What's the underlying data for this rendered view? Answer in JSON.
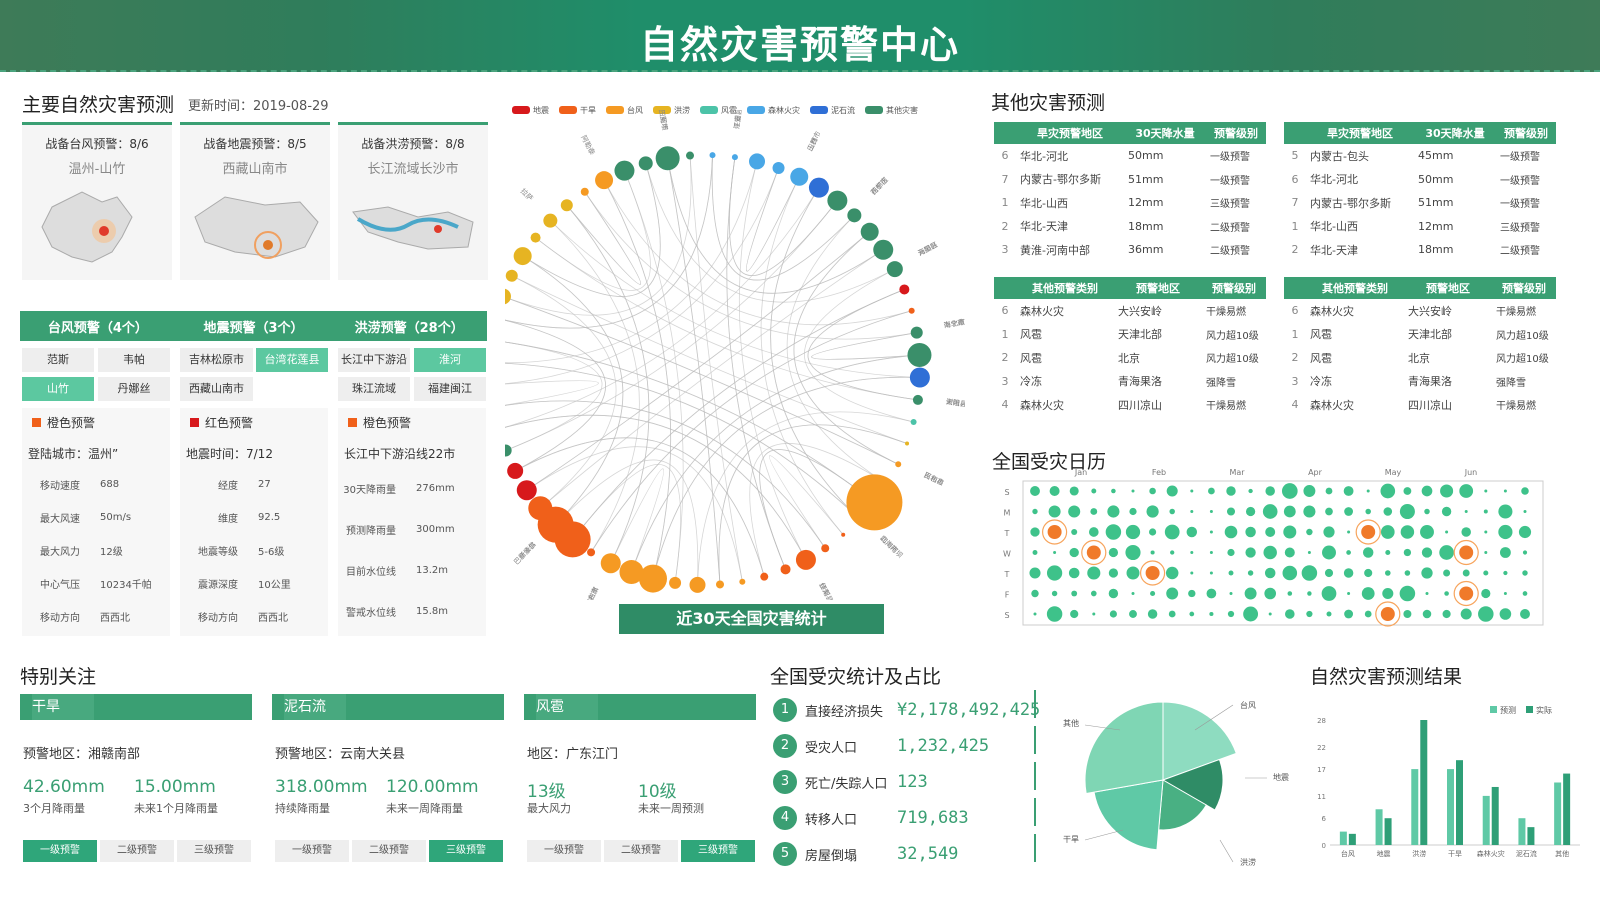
{
  "header": {
    "title": "自然灾害预警中心"
  },
  "left": {
    "title": "主要自然灾害预测",
    "update_label": "更新时间：2019-08-29",
    "cards": [
      {
        "title": "战备台风预警：8/6",
        "place": "温州-山竹"
      },
      {
        "title": "战备地震预警：8/5",
        "place": "西藏山南市"
      },
      {
        "title": "战备洪涝预警：8/8",
        "place": "长江流域长沙市"
      }
    ],
    "tabs": [
      "台风预警（4个）",
      "地震预警（3个）",
      "洪涝预警（28个）"
    ],
    "chips": {
      "typhoon": [
        "范斯",
        "韦帕",
        "山竹",
        "丹娜丝"
      ],
      "quake": [
        "吉林松原市",
        "台湾花莲县",
        "西藏山南市"
      ],
      "flood": [
        "长江中下游沿线",
        "淮河",
        "珠江流域",
        "福建闽江"
      ]
    },
    "details": [
      {
        "level": "橙色预警",
        "line": "登陆城市：温州”",
        "rows": [
          [
            "移动速度",
            "688"
          ],
          [
            "最大风速",
            "50m/s"
          ],
          [
            "最大风力",
            "12级"
          ],
          [
            "中心气压",
            "10234千帕"
          ],
          [
            "移动方向",
            "西西北"
          ]
        ]
      },
      {
        "level": "红色预警",
        "line": "地震时间：7/12",
        "rows": [
          [
            "经度",
            "27"
          ],
          [
            "维度",
            "92.5"
          ],
          [
            "地震等级",
            "5-6级"
          ],
          [
            "震源深度",
            "10公里"
          ],
          [
            "移动方向",
            "西西北"
          ]
        ]
      },
      {
        "level": "橙色预警",
        "line": "长江中下游沿线22市",
        "rows": [
          [
            "30天降雨量",
            "276mm"
          ],
          [
            "预测降雨量",
            "300mm"
          ],
          [
            "目前水位线",
            "13.2m"
          ],
          [
            "警戒水位线",
            "15.8m"
          ]
        ]
      }
    ]
  },
  "center": {
    "legend": [
      "地震",
      "干旱",
      "台风",
      "洪涝",
      "风雹",
      "森林火灾",
      "泥石流",
      "其他灾害"
    ],
    "legend_colors": [
      "#d7191c",
      "#f0601a",
      "#f59a23",
      "#e6b422",
      "#4cc3a8",
      "#49a7e6",
      "#2f6fd6",
      "#3a8f6a"
    ],
    "nodes": [
      "三亚市",
      "平遥县",
      "玉林市",
      "花都区",
      "元阳区",
      "南宁市",
      "天峨县",
      "百色市",
      "北海市",
      "红河县",
      "哈尔滨市",
      "荆州",
      "钦州市",
      "新余县",
      "银宁县",
      "哈巴河县",
      "乌尔禾区",
      "平武县",
      "拉萨",
      "阿勒泰",
      "四川阿坝",
      "江安",
      "山西",
      "西宁市",
      "海晏县",
      "海北藏族自治州",
      "谢阳县",
      "民和县",
      "四川阿坝",
      "伊犁",
      "黄南藏族自治州",
      "玉树藏族",
      "土默特右旗",
      "巴彦淖尔",
      "果洛",
      "西和县",
      "化隆县"
    ],
    "caption": "近30天全国灾害统计"
  },
  "right_top": {
    "title": "其他灾害预测",
    "tbl1_head": [
      "旱灾预警地区",
      "30天降水量",
      "预警级别"
    ],
    "tbl1": [
      [
        "6",
        "华北-河北",
        "50mm",
        "一级预警"
      ],
      [
        "7",
        "内蒙古-鄂尔多斯",
        "51mm",
        "一级预警"
      ],
      [
        "1",
        "华北-山西",
        "12mm",
        "三级预警"
      ],
      [
        "2",
        "华北-天津",
        "18mm",
        "二级预警"
      ],
      [
        "3",
        "黄淮-河南中部",
        "36mm",
        "二级预警"
      ]
    ],
    "tbl2": [
      [
        "5",
        "内蒙古-包头",
        "45mm",
        "一级预警"
      ],
      [
        "6",
        "华北-河北",
        "50mm",
        "一级预警"
      ],
      [
        "7",
        "内蒙古-鄂尔多斯",
        "51mm",
        "一级预警"
      ],
      [
        "1",
        "华北-山西",
        "12mm",
        "三级预警"
      ],
      [
        "2",
        "华北-天津",
        "18mm",
        "二级预警"
      ]
    ],
    "tbl3_head": [
      "其他预警类别",
      "预警地区",
      "预警级别"
    ],
    "tbl3": [
      [
        "6",
        "森林火灾",
        "大兴安岭",
        "干燥易燃"
      ],
      [
        "1",
        "风雹",
        "天津北部",
        "风力超10级"
      ],
      [
        "2",
        "风雹",
        "北京",
        "风力超10级"
      ],
      [
        "3",
        "冷冻",
        "青海果洛",
        "强降雪"
      ],
      [
        "4",
        "森林火灾",
        "四川凉山",
        "干燥易燃"
      ]
    ],
    "tbl4": [
      [
        "6",
        "森林火灾",
        "大兴安岭",
        "干燥易燃"
      ],
      [
        "1",
        "风雹",
        "天津北部",
        "风力超10级"
      ],
      [
        "2",
        "风雹",
        "北京",
        "风力超10级"
      ],
      [
        "3",
        "冷冻",
        "青海果洛",
        "强降雪"
      ],
      [
        "4",
        "森林火灾",
        "四川凉山",
        "干燥易燃"
      ]
    ]
  },
  "calendar": {
    "title": "全国受灾日历",
    "months": [
      "Jan",
      "Feb",
      "Mar",
      "Apr",
      "May",
      "Jun"
    ],
    "days": [
      "S",
      "M",
      "T",
      "W",
      "T",
      "F",
      "S"
    ]
  },
  "focus": {
    "title": "特别关注",
    "items": [
      {
        "name": "干旱",
        "area": "预警地区：湘赣南部",
        "v1": "42.60mm",
        "l1": "3个月降雨量",
        "v2": "15.00mm",
        "l2": "未来1个月降雨量",
        "levels": [
          "一级预警",
          "二级预警",
          "三级预警"
        ],
        "active": 0
      },
      {
        "name": "泥石流",
        "area": "预警地区：云南大关县",
        "v1": "318.00mm",
        "l1": "持续降雨量",
        "v2": "120.00mm",
        "l2": "未来一周降雨量",
        "levels": [
          "一级预警",
          "二级预警",
          "三级预警"
        ],
        "active": 2
      },
      {
        "name": "风雹",
        "area": "地区：广东江门",
        "v1": "13级",
        "l1": "最大风力",
        "v2": "10级",
        "l2": "未来一周预测",
        "levels": [
          "一级预警",
          "二级预警",
          "三级预警"
        ],
        "active": 2
      }
    ]
  },
  "stats": {
    "title": "全国受灾统计及占比",
    "rows": [
      {
        "n": "1",
        "label": "直接经济损失",
        "value": "¥2,178,492,425"
      },
      {
        "n": "2",
        "label": "受灾人口",
        "value": "1,232,425"
      },
      {
        "n": "3",
        "label": "死亡/失踪人口",
        "value": "123"
      },
      {
        "n": "4",
        "label": "转移人口",
        "value": "719,683"
      },
      {
        "n": "5",
        "label": "房屋倒塌",
        "value": "32,549"
      }
    ],
    "pie_labels": [
      "台风",
      "其他",
      "地震",
      "干旱",
      "洪涝"
    ]
  },
  "chart_data": {
    "type": "bar",
    "title": "自然灾害预测结果",
    "categories": [
      "台风",
      "地震",
      "洪涝",
      "干旱",
      "森林火灾",
      "泥石流",
      "其他"
    ],
    "series": [
      {
        "name": "预测",
        "values": [
          3,
          8,
          17,
          17,
          11,
          6,
          14
        ]
      },
      {
        "name": "实际",
        "values": [
          2.5,
          6,
          28,
          19,
          13,
          4,
          16
        ]
      }
    ],
    "yticks": [
      0,
      6,
      11,
      17,
      22,
      28
    ],
    "ylim": [
      0,
      28
    ],
    "colors": [
      "#5fc9a6",
      "#2e9f77"
    ]
  }
}
